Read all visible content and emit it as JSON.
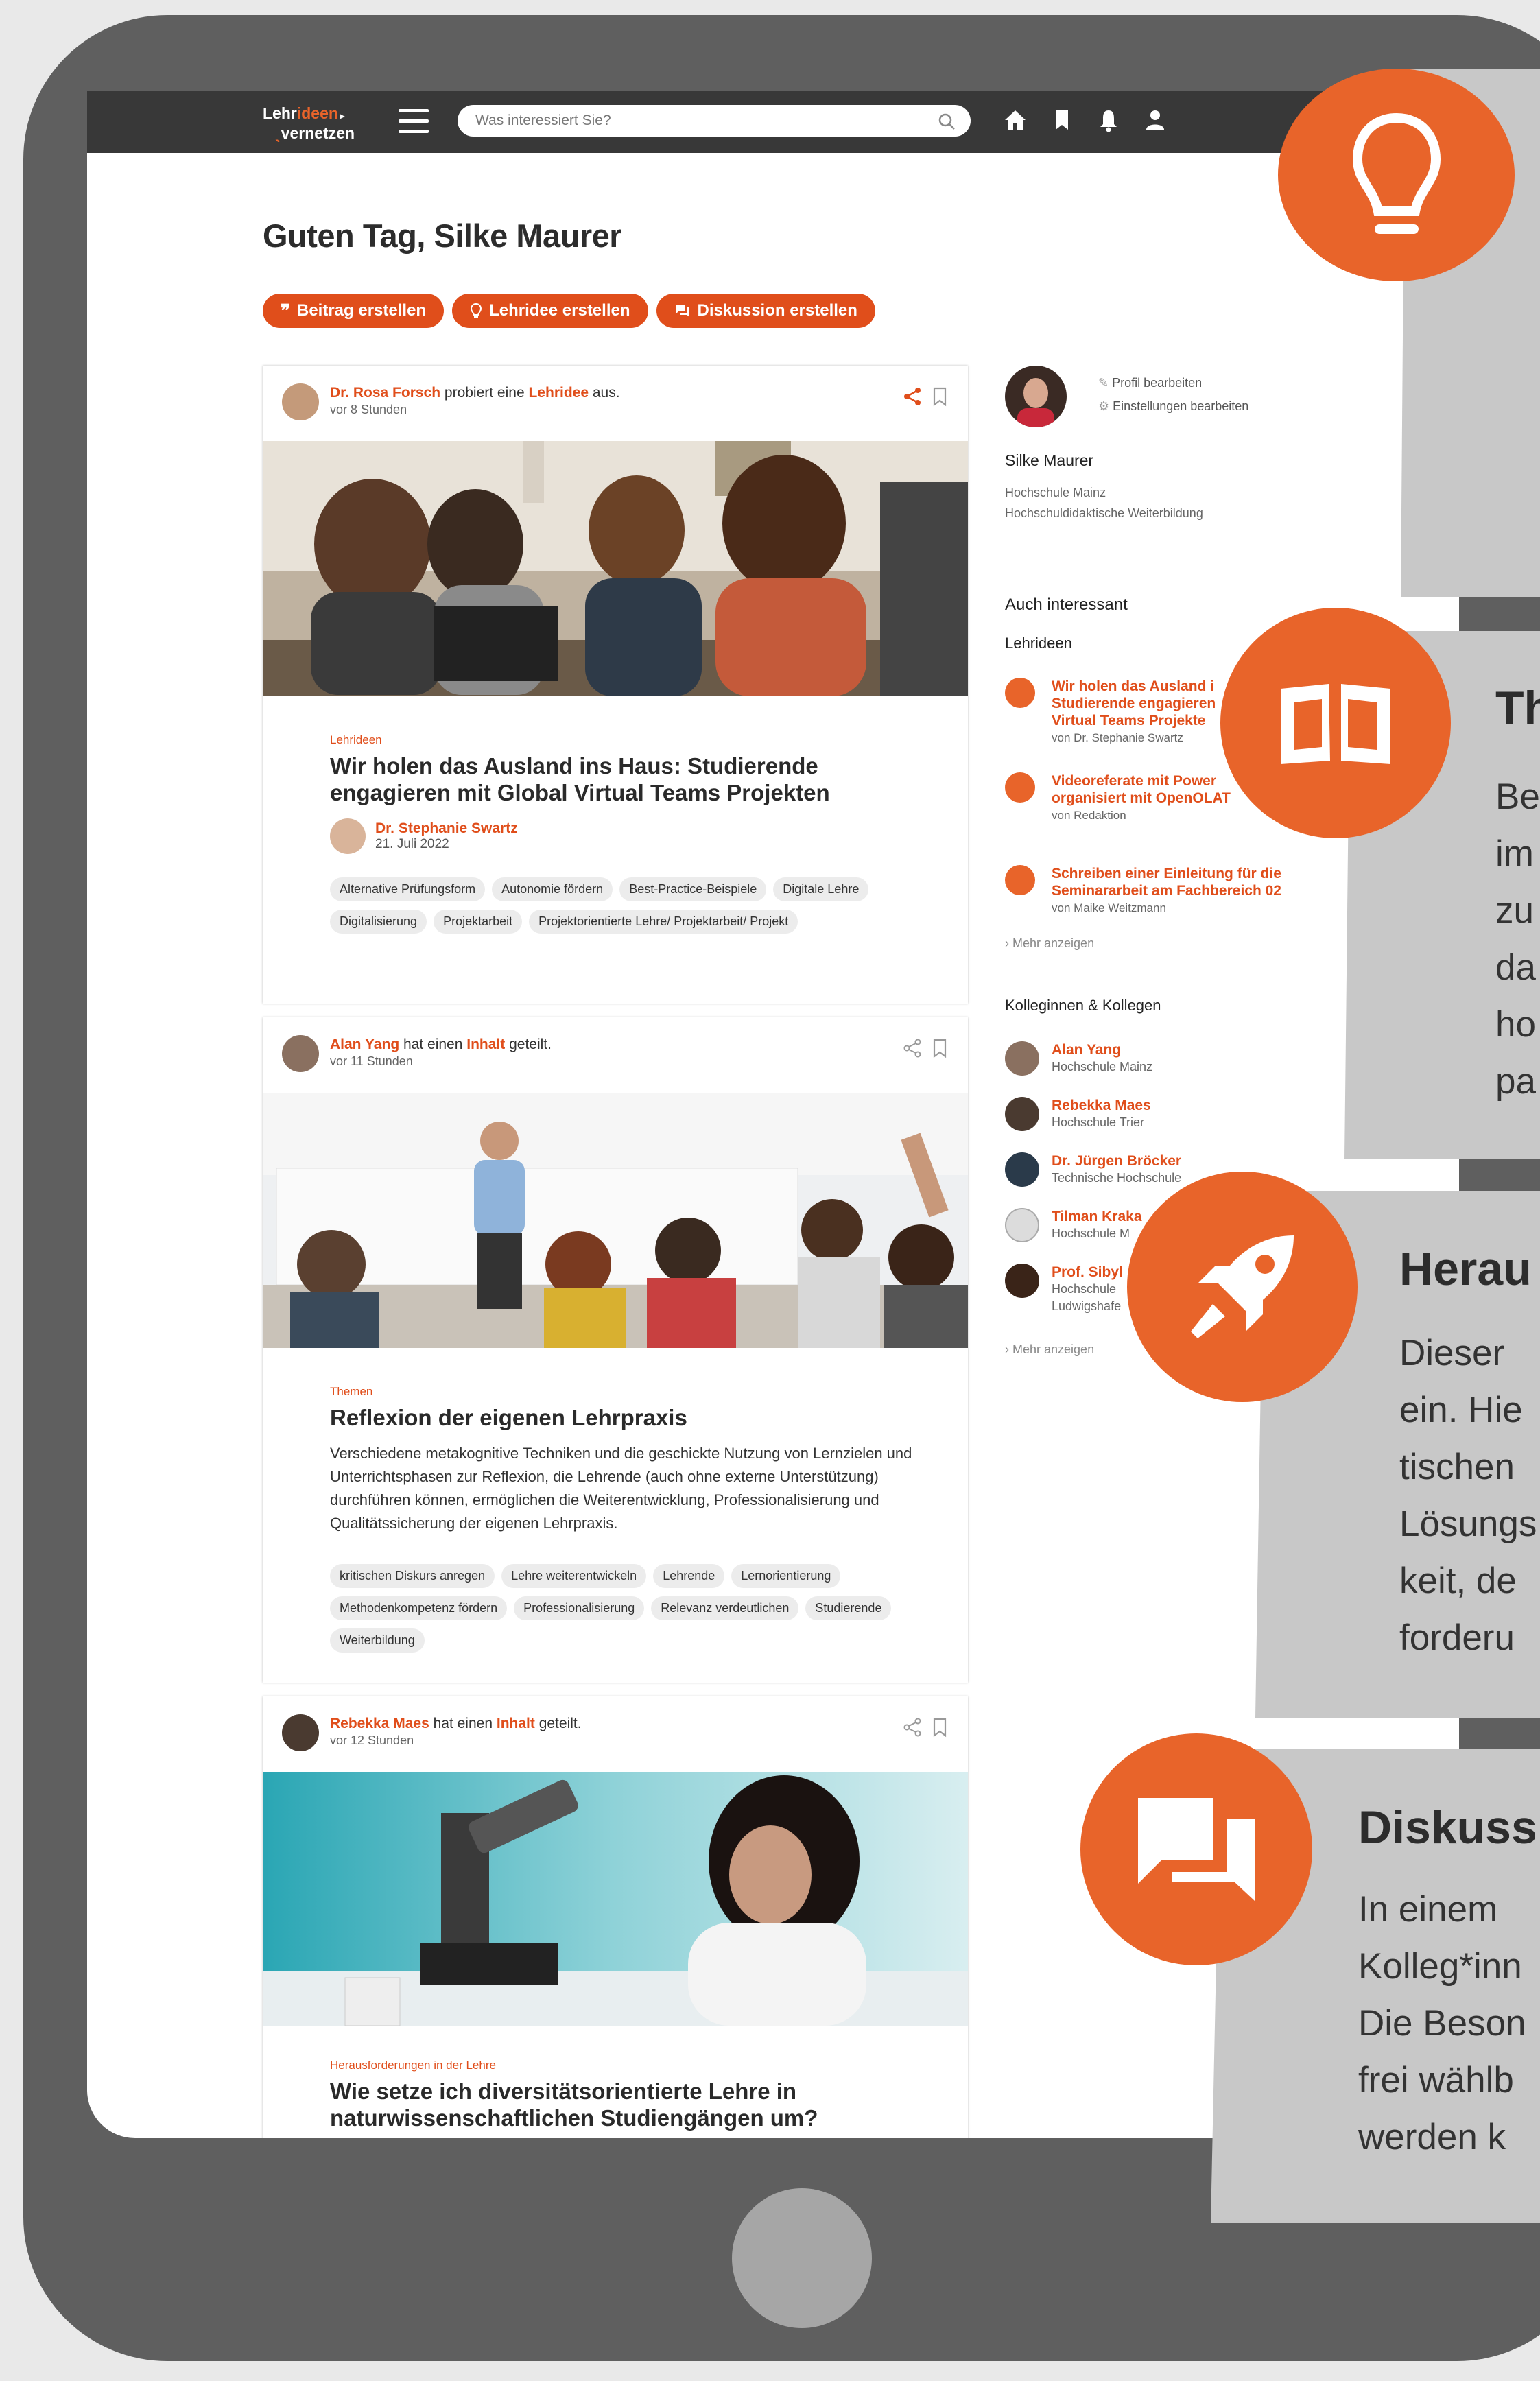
{
  "app": {
    "logo_line1_a": "Lehr",
    "logo_line1_b": "ideen",
    "logo_line2": "vernetzen"
  },
  "search": {
    "placeholder": "Was interessiert Sie?"
  },
  "topbar_icons": [
    "home-icon",
    "bookmark-icon",
    "bell-icon",
    "user-icon"
  ],
  "greeting": "Guten Tag, Silke Maurer",
  "actions": [
    {
      "label": "Beitrag erstellen",
      "icon": "quote-icon"
    },
    {
      "label": "Lehridee erstellen",
      "icon": "lightbulb-icon"
    },
    {
      "label": "Diskussion erstellen",
      "icon": "chat-icon"
    }
  ],
  "posts": [
    {
      "author": "Dr. Rosa Forsch",
      "action_pre": " probiert eine ",
      "action_link": "Lehridee",
      "action_post": " aus.",
      "time": "vor 8 Stunden",
      "category": "Lehrideen",
      "title": "Wir holen das Ausland ins Haus: Studierende engagieren mit Global Virtual Teams Projekten",
      "byline_name": "Dr. Stephanie Swartz",
      "byline_date": "21. Juli 2022",
      "tags": [
        "Alternative Prüfungsform",
        "Autonomie fördern",
        "Best-Practice-Beispiele",
        "Digitale Lehre",
        "Digitalisierung",
        "Projektarbeit",
        "Projektorientierte Lehre/ Projektarbeit/ Projekt"
      ]
    },
    {
      "author": "Alan Yang",
      "action_pre": " hat einen ",
      "action_link": "Inhalt",
      "action_post": " geteilt.",
      "time": "vor 11 Stunden",
      "category": "Themen",
      "title": "Reflexion der eigenen Lehrpraxis",
      "description": "Verschiedene metakognitive Techniken und die geschickte Nutzung von Lernzielen und Unterrichtsphasen zur Reflexion, die Lehrende (auch ohne externe Unterstützung) durchführen können, ermöglichen die Weiterentwicklung, Professionalisierung und Qualitätssicherung der eigenen Lehrpraxis.",
      "tags": [
        "kritischen Diskurs anregen",
        "Lehre weiterentwickeln",
        "Lehrende",
        "Lernorientierung",
        "Methodenkompetenz fördern",
        "Professionalisierung",
        "Relevanz verdeutlichen",
        "Studierende",
        "Weiterbildung"
      ]
    },
    {
      "author": "Rebekka Maes",
      "action_pre": " hat einen ",
      "action_link": "Inhalt",
      "action_post": " geteilt.",
      "time": "vor 12 Stunden",
      "category": "Herausforderungen in der Lehre",
      "title": "Wie setze ich diversitätsorientierte Lehre in naturwissenschaftlichen Studiengängen um?"
    }
  ],
  "profile": {
    "edit_profile": "Profil bearbeiten",
    "edit_settings": "Einstellungen bearbeiten",
    "name": "Silke Maurer",
    "institution": "Hochschule Mainz",
    "department": "Hochschuldidaktische Weiterbildung"
  },
  "sidebar": {
    "heading": "Auch interessant",
    "subheading": "Lehrideen",
    "ideas": [
      {
        "l1": "Wir holen das Ausland i",
        "l2": "Studierende engagieren",
        "l3": "Virtual Teams Projekte",
        "by": "von Dr. Stephanie Swartz"
      },
      {
        "l1": "Videoreferate mit Power",
        "l2": "organisiert mit OpenOLAT",
        "by": "von Redaktion"
      },
      {
        "l1": "Schreiben einer Einleitung für die",
        "l2": "Seminararbeit am Fachbereich 02",
        "by": "von Maike Weitzmann"
      }
    ],
    "more": "Mehr anzeigen",
    "colleagues_heading": "Kolleginnen & Kollegen",
    "colleagues": [
      {
        "name": "Alan Yang",
        "inst": "Hochschule Mainz"
      },
      {
        "name": "Rebekka Maes",
        "inst": "Hochschule Trier"
      },
      {
        "name": "Dr. Jürgen Bröcker",
        "inst": "Technische Hochschule"
      },
      {
        "name": "Tilman Kraka",
        "inst": "Hochschule M"
      },
      {
        "name": "Prof. Sibyl",
        "inst": "Hochschule",
        "inst2": "Ludwigshafe"
      }
    ],
    "more2": "Mehr anzeigen"
  },
  "panels": [
    {
      "title": "",
      "lines": []
    },
    {
      "title": "Th",
      "lines": [
        "Be",
        "im",
        "zu",
        "da",
        "ho",
        "pa"
      ]
    },
    {
      "title": "Herau",
      "lines": [
        "Dieser",
        "ein. Hie",
        "tischen",
        "Lösungs",
        "keit, de",
        "forderu"
      ]
    },
    {
      "title": "Diskuss",
      "lines": [
        "In einem",
        "Kolleg*inn",
        "Die Beson",
        "frei wählb",
        "werden k"
      ]
    }
  ],
  "colors": {
    "accent": "#e8642a",
    "device": "#5f5f5f",
    "panel": "#c8c8c8"
  }
}
